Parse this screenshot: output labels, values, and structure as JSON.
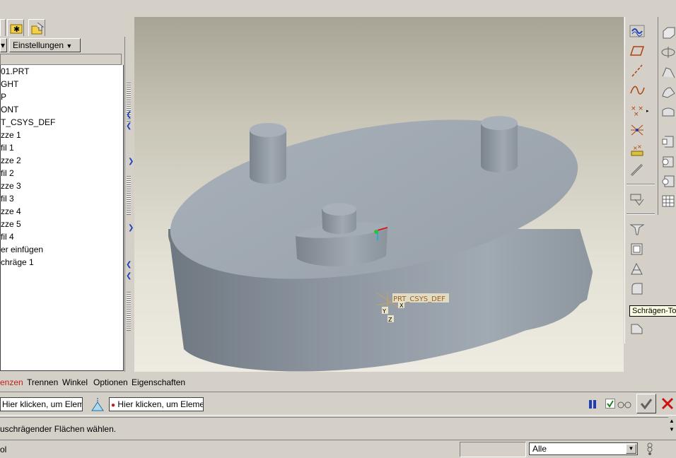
{
  "model_tree": {
    "settings_label": "Einstellungen",
    "items": [
      "01.PRT",
      "GHT",
      "P",
      "ONT",
      "T_CSYS_DEF",
      "zze 1",
      "fil 1",
      "zze 2",
      "fil 2",
      "zze 3",
      "fil 3",
      "zze 4",
      "zze 5",
      "fil 4",
      "er einfügen",
      "chräge 1"
    ]
  },
  "viewport": {
    "csys_label": "PRT_CSYS_DEF",
    "axis_x": "X",
    "axis_y": "Y",
    "axis_z": "Z"
  },
  "toolbar": {
    "tooltip": "Schrägen-Too"
  },
  "dashboard": {
    "tabs": [
      "enzen",
      "Trennen",
      "Winkel",
      "Optionen",
      "Eigenschaften"
    ],
    "collector1": "Hier klicken, um Element",
    "collector2": "Hier klicken, um Element"
  },
  "message": "uschrägender Flächen wählen.",
  "status": {
    "left": "ol",
    "filter": "Alle"
  },
  "colors": {
    "accent_blue": "#1f3fb8",
    "confirm_green": "#3a7a3a",
    "cancel_red": "#d01010",
    "model_gray": "#9aa3ad"
  }
}
